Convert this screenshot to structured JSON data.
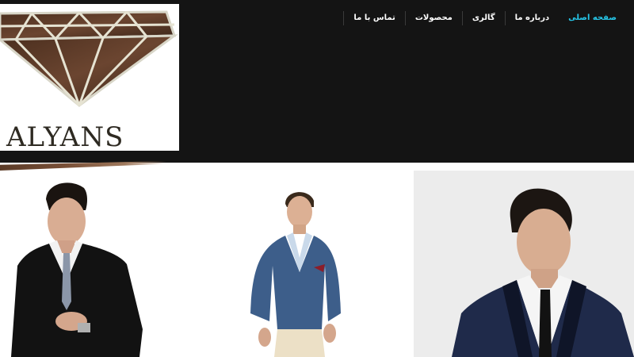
{
  "brand": {
    "logo_text": "ALYANS"
  },
  "nav": {
    "items": [
      {
        "label": "صفحه اصلی",
        "active": true
      },
      {
        "label": "درباره ما",
        "active": false
      },
      {
        "label": "گالری",
        "active": false
      },
      {
        "label": "محصولات",
        "active": false
      },
      {
        "label": "تماس با ما",
        "active": false
      }
    ]
  },
  "colors": {
    "header_bg": "#141414",
    "nav_active": "#26c6e8",
    "nav_text": "#ffffff"
  },
  "products": [
    {
      "icon": "black-suit-model-photo"
    },
    {
      "icon": "blue-blazer-model-photo"
    },
    {
      "icon": "navy-tuxedo-model-photo"
    }
  ]
}
